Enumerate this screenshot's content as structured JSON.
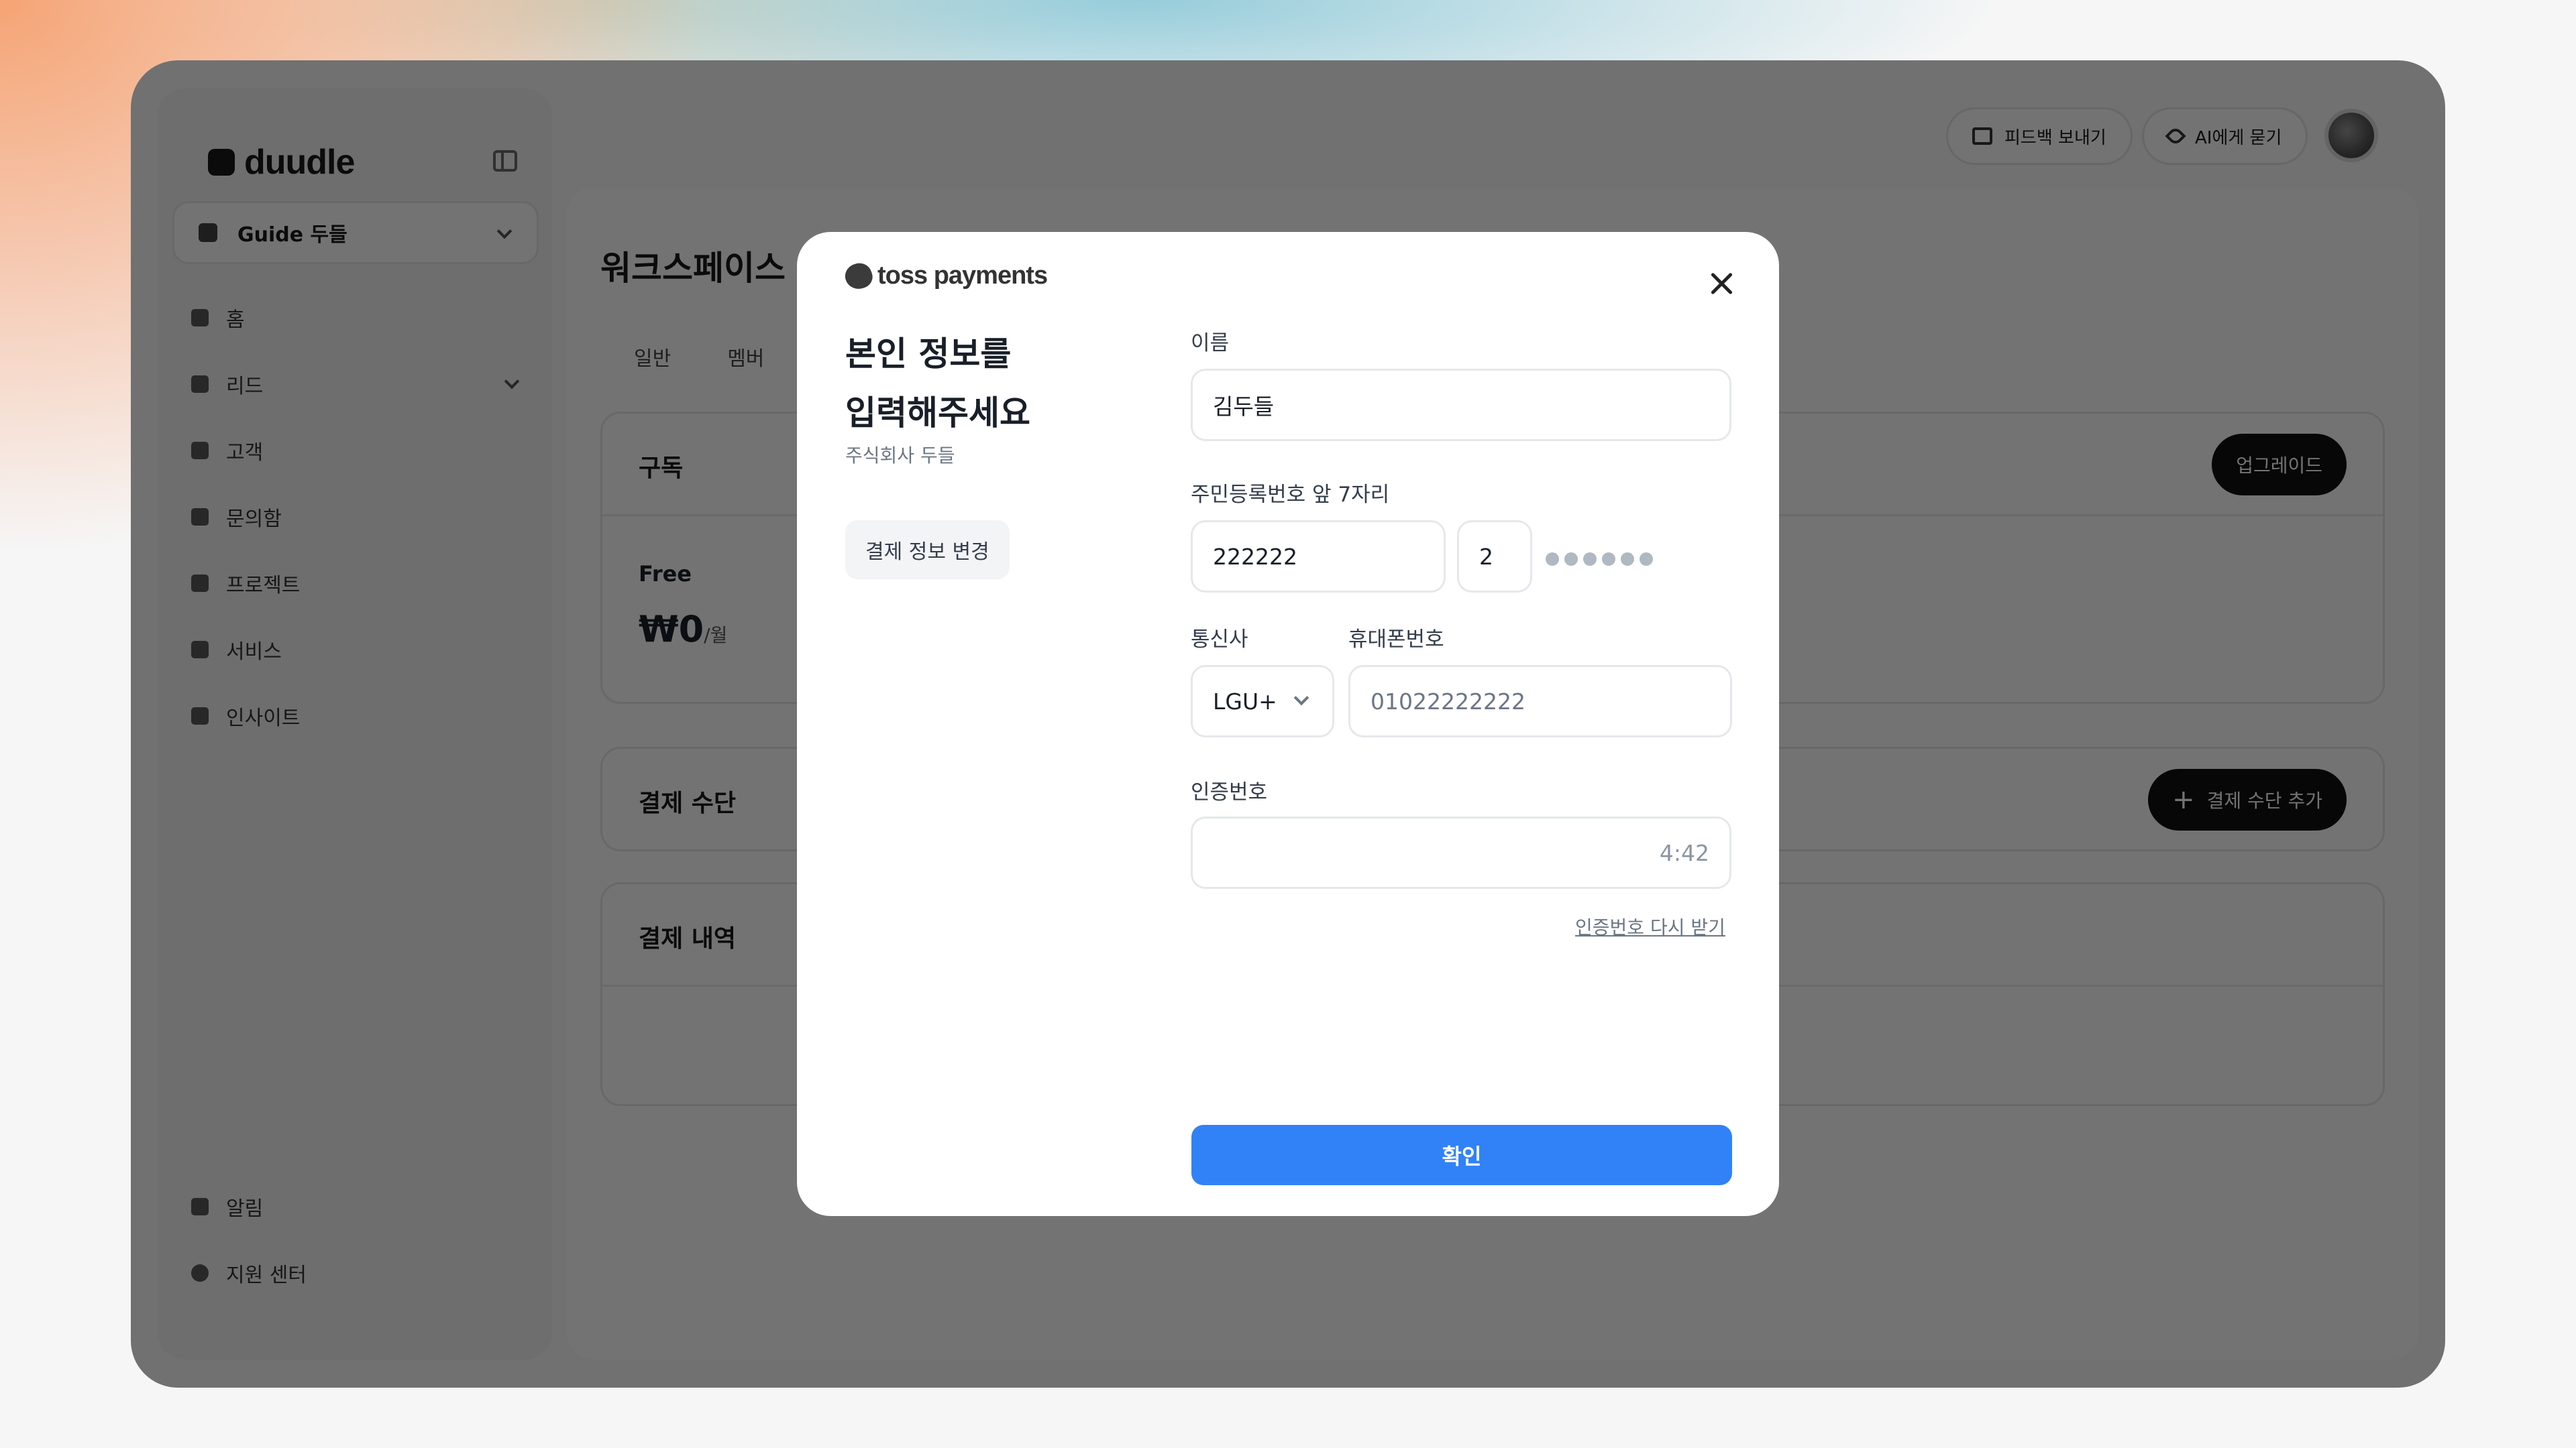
{
  "app": {
    "logo_text": "duudle",
    "workspace_select": "Guide 두들",
    "nav": [
      {
        "label": "홈",
        "icon": "home-icon"
      },
      {
        "label": "리드",
        "icon": "lead-icon"
      },
      {
        "label": "고객",
        "icon": "user-icon"
      },
      {
        "label": "문의함",
        "icon": "inbox-icon"
      },
      {
        "label": "프로젝트",
        "icon": "folder-icon"
      },
      {
        "label": "서비스",
        "icon": "briefcase-icon"
      },
      {
        "label": "인사이트",
        "icon": "chart-icon"
      }
    ],
    "nav_bottom": [
      {
        "label": "알림",
        "icon": "bell-icon"
      },
      {
        "label": "지원 센터",
        "icon": "help-icon"
      }
    ],
    "topbar": {
      "feedback_label": "피드백 보내기",
      "ai_label": "AI에게 묻기"
    },
    "page_title": "워크스페이스",
    "tabs": [
      "일반",
      "멤버"
    ],
    "subscription": {
      "title": "구독",
      "upgrade_label": "업그레이드",
      "plan_name": "Free",
      "plan_price": "₩0",
      "plan_period": "/월"
    },
    "payment_method": {
      "title": "결제 수단",
      "add_label": "결제 수단 추가"
    },
    "payment_history": {
      "title": "결제 내역"
    }
  },
  "modal": {
    "brand": "toss payments",
    "heading_line1": "본인 정보를",
    "heading_line2": "입력해주세요",
    "company": "주식회사 두들",
    "change_label": "결제 정보 변경",
    "name_label": "이름",
    "name_value": "김두들",
    "rrn_label": "주민등록번호 앞 7자리",
    "rrn_front": "222222",
    "rrn_back_first": "2",
    "carrier_label": "통신사",
    "carrier_value": "LGU+",
    "phone_label": "휴대폰번호",
    "phone_value": "01022222222",
    "code_label": "인증번호",
    "code_value": "",
    "timer": "4:42",
    "resend_label": "인증번호 다시 받기",
    "confirm_label": "확인"
  }
}
